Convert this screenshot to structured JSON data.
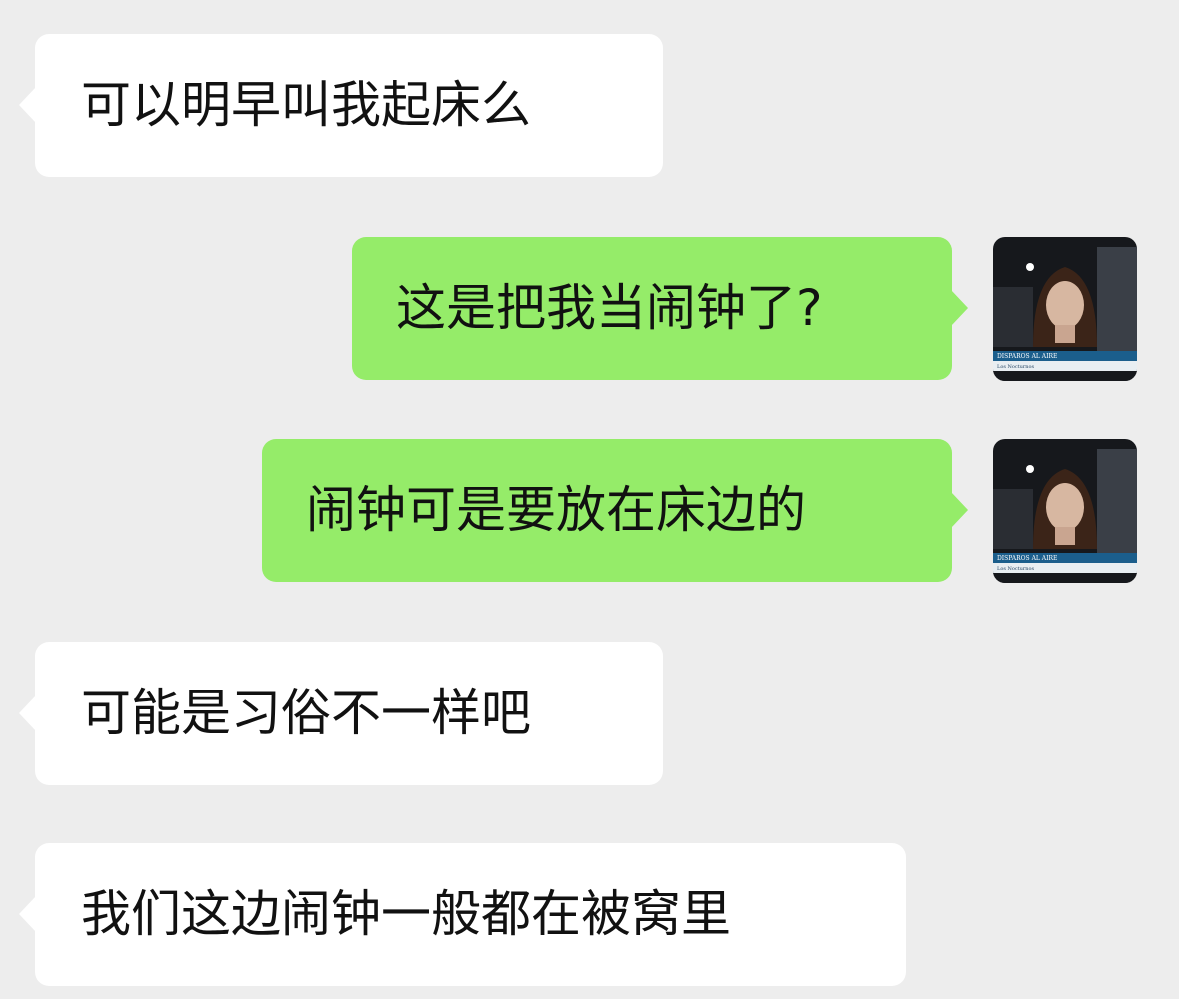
{
  "messages": [
    {
      "side": "received",
      "text": "可以明早叫我起床么"
    },
    {
      "side": "sent",
      "text": "这是把我当闹钟了?"
    },
    {
      "side": "sent",
      "text": "闹钟可是要放在床边的"
    },
    {
      "side": "received",
      "text": "可能是习俗不一样吧"
    },
    {
      "side": "received",
      "text": "我们这边闹钟一般都在被窝里"
    }
  ],
  "avatar": {
    "caption": "DISPAROS AL AIRE",
    "subcaption": "Los Nocturnos"
  },
  "colors": {
    "background": "#ededed",
    "received_bubble": "#ffffff",
    "sent_bubble": "#95ec69",
    "text": "#111111"
  }
}
